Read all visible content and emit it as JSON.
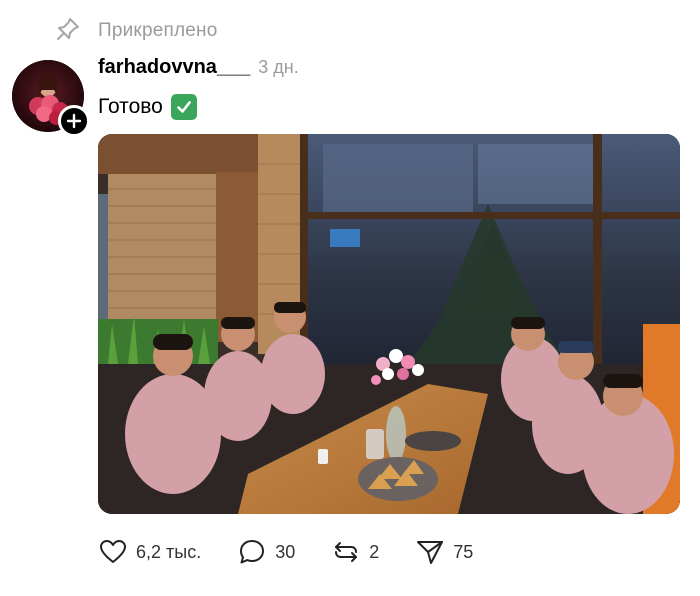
{
  "pinned": {
    "label": "Прикреплено",
    "icon": "pin-icon"
  },
  "post": {
    "username": "farhadovvna___",
    "time": "3 дн.",
    "text": "Готово",
    "emoji": "check-mark-button-emoji"
  },
  "actions": {
    "likes": "6,2 тыс.",
    "comments": "30",
    "reposts": "2",
    "shares": "75"
  },
  "colors": {
    "muted_text": "#9a9a9a",
    "emoji_green": "#3ba55c"
  }
}
